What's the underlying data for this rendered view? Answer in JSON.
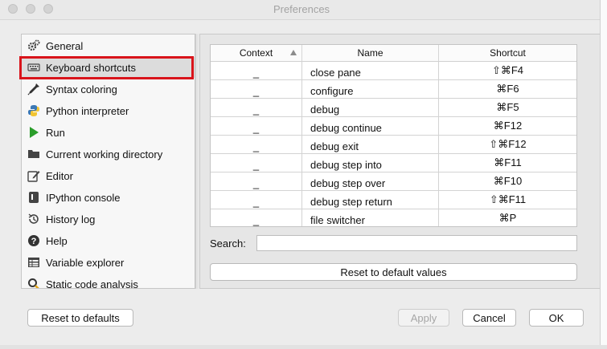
{
  "window": {
    "title": "Preferences"
  },
  "sidebar": {
    "items": [
      {
        "label": "General",
        "icon": "gears-icon"
      },
      {
        "label": "Keyboard shortcuts",
        "icon": "keyboard-icon",
        "selected": true
      },
      {
        "label": "Syntax coloring",
        "icon": "eyedropper-icon"
      },
      {
        "label": "Python interpreter",
        "icon": "python-icon"
      },
      {
        "label": "Run",
        "icon": "play-icon"
      },
      {
        "label": "Current working directory",
        "icon": "folder-icon"
      },
      {
        "label": "Editor",
        "icon": "edit-icon"
      },
      {
        "label": "IPython console",
        "icon": "console-icon"
      },
      {
        "label": "History log",
        "icon": "history-icon"
      },
      {
        "label": "Help",
        "icon": "help-icon"
      },
      {
        "label": "Variable explorer",
        "icon": "table-icon"
      },
      {
        "label": "Static code analysis",
        "icon": "magnifier-icon"
      }
    ]
  },
  "table": {
    "headers": {
      "context": "Context",
      "name": "Name",
      "shortcut": "Shortcut"
    },
    "rows": [
      {
        "context": "_",
        "name": "close pane",
        "shortcut": "⇧⌘F4"
      },
      {
        "context": "_",
        "name": "configure",
        "shortcut": "⌘F6"
      },
      {
        "context": "_",
        "name": "debug",
        "shortcut": "⌘F5"
      },
      {
        "context": "_",
        "name": "debug continue",
        "shortcut": "⌘F12"
      },
      {
        "context": "_",
        "name": "debug exit",
        "shortcut": "⇧⌘F12"
      },
      {
        "context": "_",
        "name": "debug step into",
        "shortcut": "⌘F11"
      },
      {
        "context": "_",
        "name": "debug step over",
        "shortcut": "⌘F10"
      },
      {
        "context": "_",
        "name": "debug step return",
        "shortcut": "⇧⌘F11"
      },
      {
        "context": "_",
        "name": "file switcher",
        "shortcut": "⌘P"
      }
    ]
  },
  "search": {
    "label": "Search:",
    "value": ""
  },
  "buttons": {
    "reset_default_values": "Reset to default values",
    "reset_to_defaults": "Reset to defaults",
    "apply": "Apply",
    "cancel": "Cancel",
    "ok": "OK"
  },
  "colors": {
    "selection_outline": "#d9141b",
    "run_green": "#2a9d2a"
  }
}
